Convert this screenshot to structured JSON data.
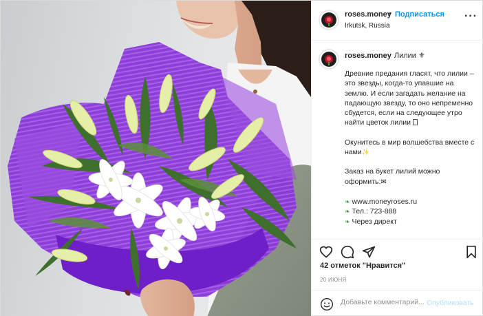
{
  "header": {
    "username": "roses.money",
    "separator": "•",
    "follow_label": "Подписаться",
    "location": "Irkutsk, Russia",
    "more_label": "···"
  },
  "caption": {
    "username": "roses.money",
    "title": "Лилии ⚜",
    "paragraph1": "Древние предания гласят, что лилии – это звезды, когда-то упавшие на землю. И если загадать желание на падающую звезду, то оно непременно сбудется, если на следующее утро найти цветок лилии",
    "paragraph2": "Окунитесь в мир волшебства вместе с нами",
    "paragraph2_emoji": "✨",
    "paragraph3": "Заказ на букет лилий можно оформить:",
    "paragraph3_emoji": "✉",
    "link1": "www.moneyroses.ru",
    "phone": "Тел.: 723-888",
    "direct": "Через директ"
  },
  "actions": {
    "like_icon": "heart-icon",
    "comment_icon": "comment-icon",
    "share_icon": "share-icon",
    "save_icon": "bookmark-icon"
  },
  "likes_text": "42 отметок \"Нравится\"",
  "date_text": "20 ИЮНЯ",
  "comment": {
    "placeholder": "Добавьте комментарий...",
    "publish_label": "Опубликовать"
  },
  "colors": {
    "accent": "#0095f6",
    "publish_disabled": "#b2dffc",
    "wrap_purple": "#7d2bd6"
  }
}
